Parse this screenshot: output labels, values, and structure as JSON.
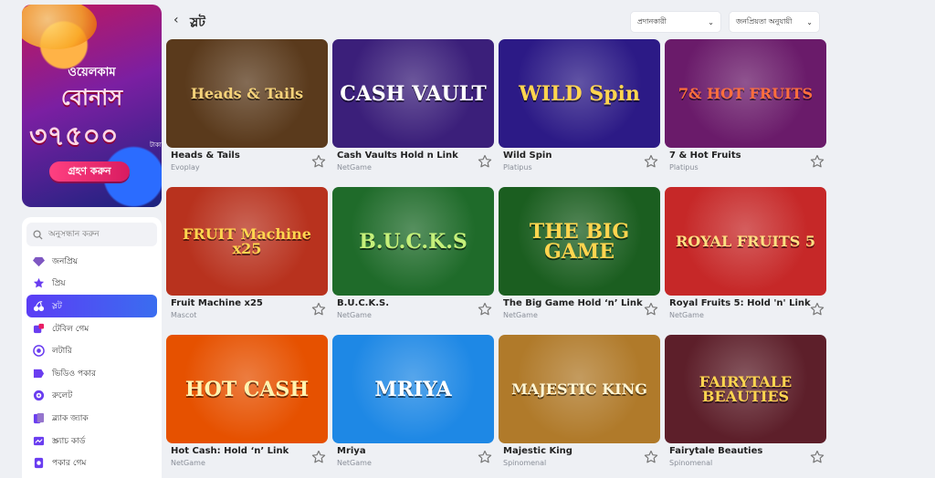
{
  "banner": {
    "line1": "ওয়েলকাম",
    "line2": "বোনাস",
    "amount": "৩৭৫০০",
    "currency": "টাকা",
    "cta": "গ্রহণ করুন"
  },
  "sidebar": {
    "search_placeholder": "অনুসন্ধান করুন",
    "items": [
      {
        "label": "জনপ্রিয়",
        "icon": "diamond-icon",
        "active": false
      },
      {
        "label": "প্রিয়",
        "icon": "star-icon",
        "active": false
      },
      {
        "label": "স্লট",
        "icon": "cherry-icon",
        "active": true
      },
      {
        "label": "টেবিল গেম",
        "icon": "dice-icon",
        "active": false
      },
      {
        "label": "লটারি",
        "icon": "lottery-icon",
        "active": false
      },
      {
        "label": "ভিডিও পকার",
        "icon": "video-poker-icon",
        "active": false
      },
      {
        "label": "রুলেট",
        "icon": "roulette-icon",
        "active": false
      },
      {
        "label": "ব্ল্যাক জ্যাক",
        "icon": "blackjack-icon",
        "active": false
      },
      {
        "label": "স্ক্র্যাচ কার্ড",
        "icon": "scratch-card-icon",
        "active": false
      },
      {
        "label": "পকার গেম",
        "icon": "poker-icon",
        "active": false
      }
    ]
  },
  "header": {
    "title": "স্লট",
    "provider_select": "প্রদানকারী",
    "sort_select": "জনপ্রিয়তা অনুযায়ী"
  },
  "games": [
    {
      "name": "Heads & Tails",
      "provider": "Evoplay",
      "art": "Heads & Tails",
      "bg": "#5a3a1c",
      "fg": "#f5d27a"
    },
    {
      "name": "Cash Vaults Hold n Link",
      "provider": "NetGame",
      "art": "CASH VAULT",
      "bg": "#3b1f7a",
      "fg": "#ffffff"
    },
    {
      "name": "Wild Spin",
      "provider": "Platipus",
      "art": "WILD Spin",
      "bg": "#2c1a86",
      "fg": "#ffd54f"
    },
    {
      "name": "7 & Hot Fruits",
      "provider": "Platipus",
      "art": "7& HOT FRUITS",
      "bg": "#6a1b6a",
      "fg": "#ff6f3c"
    },
    {
      "name": "Fruit Machine x25",
      "provider": "Mascot",
      "art": "FRUIT Machine x25",
      "bg": "#b8321e",
      "fg": "#ffd54f"
    },
    {
      "name": "B.U.C.K.S.",
      "provider": "NetGame",
      "art": "B.U.C.K.S",
      "bg": "#1f6b2a",
      "fg": "#c5f07a"
    },
    {
      "name": "The Big Game Hold ‘n’ Link",
      "provider": "NetGame",
      "art": "THE BIG GAME",
      "bg": "#1b5e20",
      "fg": "#ffd54f"
    },
    {
      "name": "Royal Fruits 5: Hold 'n' Link",
      "provider": "NetGame",
      "art": "ROYAL FRUITS 5",
      "bg": "#c62828",
      "fg": "#ffe082"
    },
    {
      "name": "Hot Cash: Hold ‘n’ Link",
      "provider": "NetGame",
      "art": "HOT CASH",
      "bg": "#e65100",
      "fg": "#fff3b0"
    },
    {
      "name": "Mriya",
      "provider": "NetGame",
      "art": "MRIYA",
      "bg": "#1e88e5",
      "fg": "#ffffff"
    },
    {
      "name": "Majestic King",
      "provider": "Spinomenal",
      "art": "MAJESTIC KING",
      "bg": "#b07a2a",
      "fg": "#fff6d5"
    },
    {
      "name": "Fairytale Beauties",
      "provider": "Spinomenal",
      "art": "FAIRYTALE BEAUTIES",
      "bg": "#5d1f2a",
      "fg": "#ffd54f"
    }
  ]
}
